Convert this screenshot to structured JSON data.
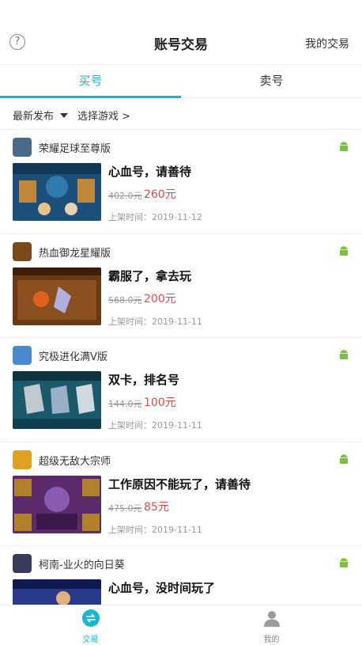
{
  "header": {
    "title": "账号交易",
    "right_link": "我的交易",
    "help_symbol": "?"
  },
  "tabs": [
    {
      "label": "买号",
      "active": true
    },
    {
      "label": "卖号",
      "active": false
    }
  ],
  "filters": {
    "sort_label": "最新发布",
    "game_label": "选择游戏 >"
  },
  "time_prefix": "上架时间：",
  "listings": [
    {
      "game": "荣耀足球至尊版",
      "title": "心血号，请善待",
      "old_price": "402.0元",
      "price": "260元",
      "time": "上架时间：2019-11-12",
      "thumb_color": "#1c4f7a",
      "icon_color": "#4a6a8a"
    },
    {
      "game": "热血御龙星耀版",
      "title": "霸服了，拿去玩",
      "old_price": "568.0元",
      "price": "200元",
      "time": "上架时间：2019-11-11",
      "thumb_color": "#6a3a14",
      "icon_color": "#7a4a1a"
    },
    {
      "game": "究极进化满V版",
      "title": "双卡，排名号",
      "old_price": "144.0元",
      "price": "100元",
      "time": "上架时间：2019-11-11",
      "thumb_color": "#1a5a6a",
      "icon_color": "#4a8ad0"
    },
    {
      "game": "超级无敌大宗师",
      "title": "工作原因不能玩了，请善待",
      "old_price": "475.0元",
      "price": "85元",
      "time": "上架时间：2019-11-11",
      "thumb_color": "#5a2a6a",
      "icon_color": "#e0a020"
    },
    {
      "game": "柯南-业火的向日葵",
      "title": "心血号，没时间玩了",
      "old_price": "",
      "price": "",
      "time": "",
      "thumb_color": "#2a3a8a",
      "icon_color": "#3a3a5a"
    }
  ],
  "bottom_nav": [
    {
      "label": "交易",
      "icon": "trade-icon",
      "active": true
    },
    {
      "label": "我的",
      "icon": "user-icon",
      "active": false
    }
  ],
  "colors": {
    "accent": "#1ab5d6",
    "price": "#e04848",
    "android": "#7bc043"
  }
}
